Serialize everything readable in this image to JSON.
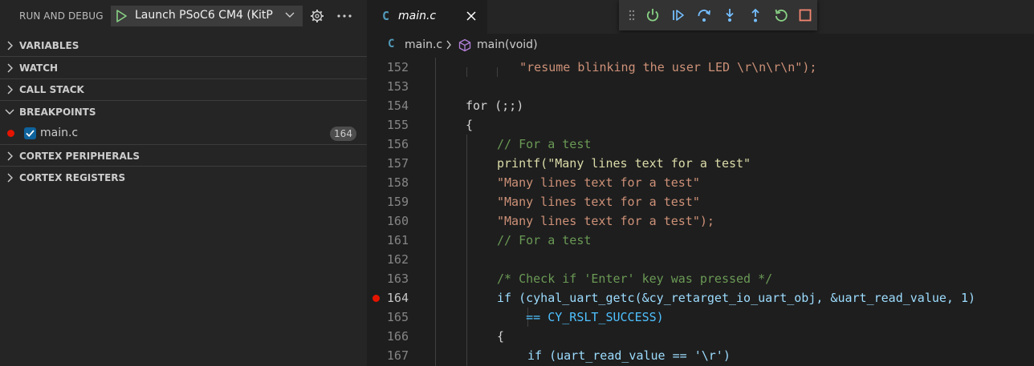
{
  "sidebar": {
    "title": "RUN AND DEBUG",
    "launch_config": "Launch PSoC6 CM4 (KitP",
    "sections": [
      "VARIABLES",
      "WATCH",
      "CALL STACK",
      "BREAKPOINTS",
      "CORTEX PERIPHERALS",
      "CORTEX REGISTERS"
    ],
    "breakpoint": {
      "file": "main.c",
      "line": "164",
      "enabled": true
    }
  },
  "editor": {
    "tab": {
      "label": "main.c",
      "icon": "C"
    },
    "breadcrumb": {
      "icon": "C",
      "file": "main.c",
      "symbol": "main(void)"
    },
    "debug_toolbar": [
      "grip-icon",
      "continue-icon",
      "step-over-icon",
      "step-into-icon",
      "step-out-icon",
      "restart-icon",
      "stop-icon"
    ],
    "lines": [
      {
        "n": "152",
        "t": "    \"resume blinking the user LED \\r\\n\\r\\n\");"
      },
      {
        "n": "153",
        "t": ""
      },
      {
        "n": "154",
        "t": "for (;;)"
      },
      {
        "n": "155",
        "t": "{"
      },
      {
        "n": "156",
        "t": "// For a test"
      },
      {
        "n": "157",
        "t": "printf(\"Many lines text for a test\""
      },
      {
        "n": "158",
        "t": "\"Many lines text for a test\""
      },
      {
        "n": "159",
        "t": "\"Many lines text for a test\""
      },
      {
        "n": "160",
        "t": "\"Many lines text for a test\");"
      },
      {
        "n": "161",
        "t": "// For a test"
      },
      {
        "n": "162",
        "t": ""
      },
      {
        "n": "163",
        "t": "/* Check if 'Enter' key was pressed */"
      },
      {
        "n": "164",
        "t": "if (cyhal_uart_getc(&cy_retarget_io_uart_obj, &uart_read_value, 1)"
      },
      {
        "n": "165",
        "t": "    == CY_RSLT_SUCCESS)"
      },
      {
        "n": "166",
        "t": "{"
      },
      {
        "n": "167",
        "t": "if (uart_read_value == '\\r')"
      }
    ]
  },
  "colors": {
    "accent_blue": "#75beff",
    "continue_green": "#89d185",
    "stop_red": "#f48771",
    "breakpoint_red": "#e51400"
  }
}
